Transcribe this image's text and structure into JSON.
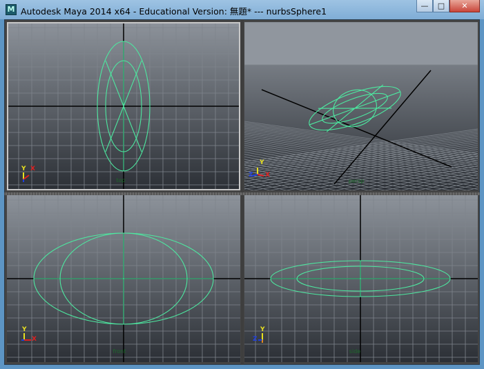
{
  "window": {
    "title": "Autodesk Maya 2014 x64 - Educational Version: 無題*    ---    nurbsSphere1",
    "app_icon": "maya-icon",
    "buttons": {
      "minimize": "—",
      "maximize": "□",
      "close": "✕"
    }
  },
  "viewports": {
    "top": {
      "label": "top"
    },
    "persp": {
      "label": "persp"
    },
    "front": {
      "label": "front"
    },
    "side": {
      "label": "side"
    }
  },
  "axes": {
    "x": "X",
    "y": "Y",
    "z": "Z"
  },
  "colors": {
    "curve": "#4de8a0",
    "grid": "#7f858c",
    "axis_line": "#000000",
    "axis_x": "#e02020",
    "axis_y": "#e8e020",
    "axis_z": "#2040e0",
    "label": "#1c6a2a"
  }
}
